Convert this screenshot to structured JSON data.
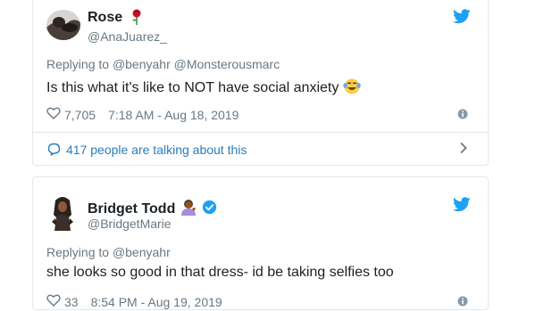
{
  "tweets": [
    {
      "name": "Rose",
      "name_emoji": "rose-icon",
      "handle": "@AnaJuarez_",
      "replying_prefix": "Replying to",
      "replying_to": "@benyahr @Monsterousmarc",
      "text": "Is this what it's like to NOT have social anxiety",
      "text_emoji": "tears-of-joy-emoji",
      "likes": "7,705",
      "time": "7:18 AM - Aug 18, 2019",
      "talking": "417 people are talking about this"
    },
    {
      "name": "Bridget Todd",
      "name_emoji": "woman-tipping-hand-emoji",
      "verified": true,
      "handle": "@BridgetMarie",
      "replying_prefix": "Replying to",
      "replying_to": "@benyahr",
      "text": "she looks so good in that dress- id be taking selfies too",
      "likes": "33",
      "time": "8:54 PM - Aug 19, 2019"
    }
  ],
  "colors": {
    "twitter_blue": "#1da1f2",
    "link_blue": "#2b7bb9",
    "text": "#1c2022",
    "muted": "#697882",
    "border": "#e1e8ed"
  }
}
